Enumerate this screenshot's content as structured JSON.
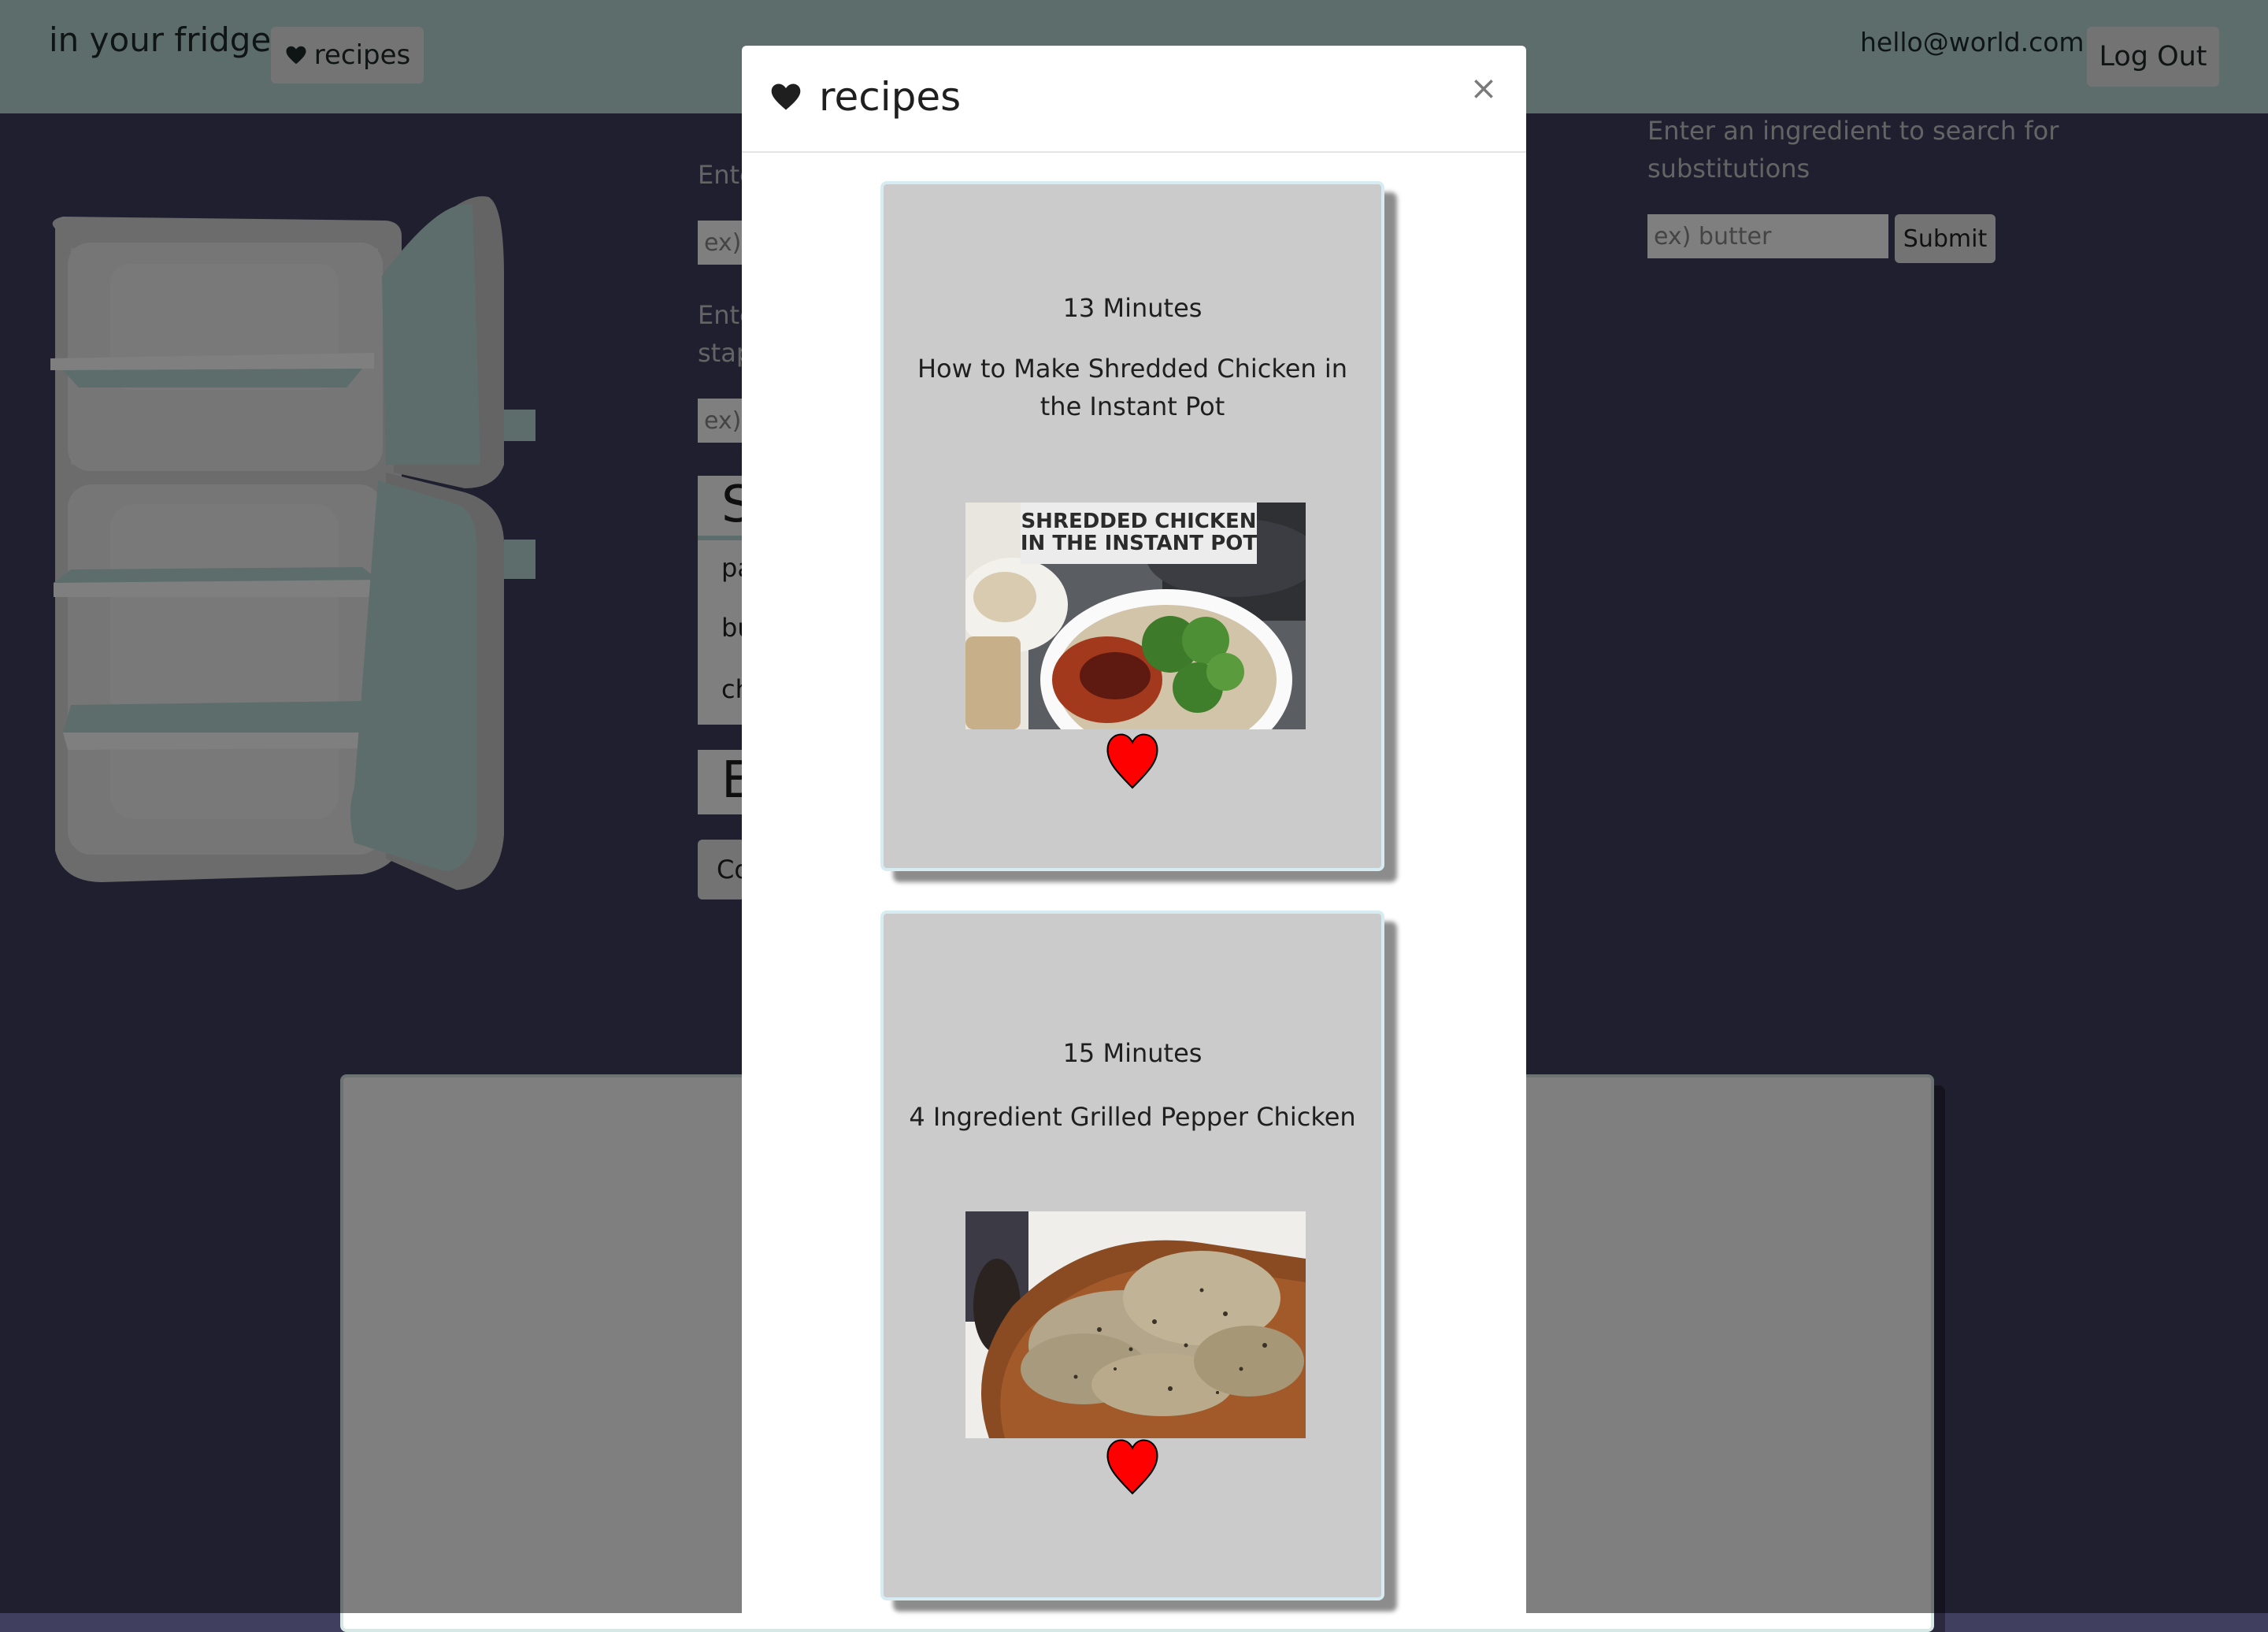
{
  "navbar": {
    "brand": "in your fridge",
    "recipes_label": "recipes",
    "email": "hello@world.com",
    "logout_label": "Log Out"
  },
  "background": {
    "ingredient_prompt_partial": "Ente",
    "input_partial_1": "ex) ",
    "staples_prompt_partial_1": "Ente",
    "staples_prompt_partial_2": "stap",
    "input_partial_2": "ex) ",
    "list_header_partial": "S",
    "list_items_partial": [
      "pa",
      "bu",
      "ch"
    ],
    "second_header_partial": "E",
    "button_partial": "Co",
    "substitution_prompt": "Enter an ingredient to search for substitutions",
    "substitution_placeholder": "ex) butter",
    "submit_label": "Submit"
  },
  "modal": {
    "title": "recipes",
    "close_symbol": "×",
    "recipes": [
      {
        "time": "13 Minutes",
        "title": "How to Make Shredded Chicken in the Instant Pot",
        "image_caption_line1": "SHREDDED CHICKEN",
        "image_caption_line2": "IN THE INSTANT POT"
      },
      {
        "time": "15 Minutes",
        "title": "4 Ingredient Grilled Pepper Chicken"
      }
    ]
  },
  "colors": {
    "navbar": "#b8dbd6",
    "page_background": "#413f5f",
    "card_background": "#cbcbcb",
    "heart": "#ff0000"
  },
  "icons": [
    "heart-icon",
    "close-icon",
    "fridge-illustration"
  ]
}
